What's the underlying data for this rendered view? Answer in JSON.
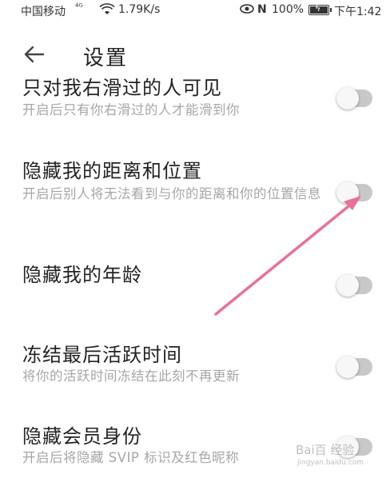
{
  "status_bar": {
    "carrier": "中国移动",
    "signal": "⁴ᴳ",
    "speed": "1.79K/s",
    "battery_pct": "100%",
    "time": "下午1:42"
  },
  "header": {
    "title": "设置"
  },
  "settings": [
    {
      "title": "只对我右滑过的人可见",
      "desc": "开启后只有你右滑过的人才能滑到你",
      "enabled": false
    },
    {
      "title": "隐藏我的距离和位置",
      "desc": "开启后别人将无法看到与你的距离和你的位置信息",
      "enabled": false
    },
    {
      "title": "隐藏我的年龄",
      "desc": "",
      "enabled": false
    },
    {
      "title": "冻结最后活跃时间",
      "desc": "将你的活跃时间冻结在此刻不再更新",
      "enabled": false
    },
    {
      "title": "隐藏会员身份",
      "desc": "开启后将隐藏 SVIP 标识及红色昵称",
      "enabled": false
    }
  ],
  "annotation": {
    "arrow_color": "#e8709a"
  },
  "watermark": {
    "text": "Bai百 经验",
    "sub": "jingyan.baidu.com"
  }
}
